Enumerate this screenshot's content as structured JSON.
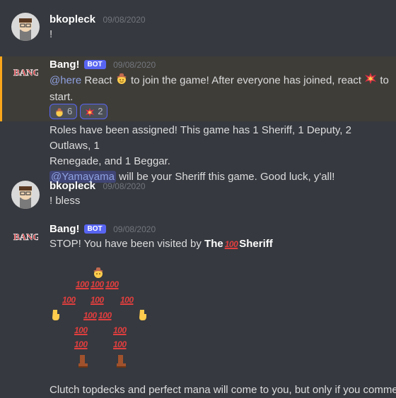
{
  "messages": [
    {
      "username": "bkopleck",
      "timestamp": "09/08/2020",
      "text": "!"
    },
    {
      "username": "Bang!",
      "bot_tag": "BOT",
      "timestamp": "09/08/2020",
      "logo_text": "BANG!",
      "mention": "@here",
      "text_a": " React ",
      "text_b": " to join the game! After everyone has joined, react ",
      "text_c": " to",
      "text_d": "start.",
      "reactions": [
        {
          "emoji": "cowboy-emoji",
          "count": "6"
        },
        {
          "emoji": "collision-emoji",
          "count": "2"
        }
      ],
      "followup_line1": "Roles have been assigned! This game has 1 Sheriff, 1 Deputy, 2 Outlaws, 1",
      "followup_line2": "Renegade, and 1 Beggar.",
      "followup_mention": "@Yamayama",
      "followup_line3": " will be your Sheriff this game. Good luck, y'all!"
    },
    {
      "username": "bkopleck",
      "timestamp": "09/08/2020",
      "text": "! bless"
    },
    {
      "username": "Bang!",
      "bot_tag": "BOT",
      "timestamp": "09/08/2020",
      "logo_text": "BANG!",
      "text_a": "STOP! You have been visited by ",
      "bold_a": "The",
      "bold_b": "Sheriff",
      "hundred": "100",
      "bottom_text": "Clutch topdecks and perfect mana will come to you, but only if you comment"
    }
  ],
  "colors": {
    "background": "#36393f",
    "highlight": "#3f3d38",
    "mention_bar": "#faa61a",
    "bot_badge": "#5865f2",
    "hundred_red": "#e23e3e"
  }
}
